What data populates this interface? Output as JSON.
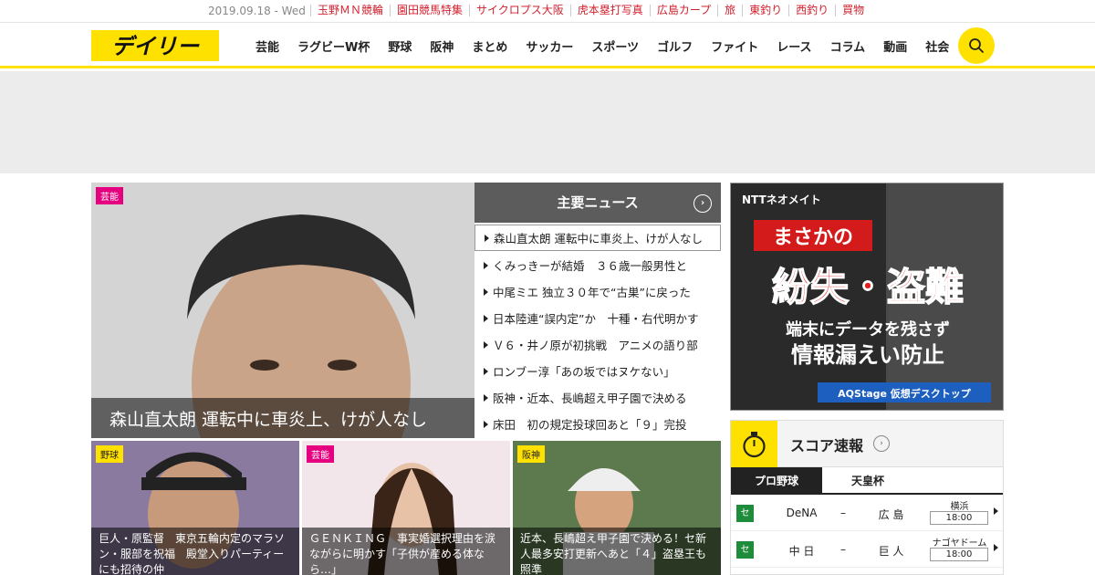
{
  "topbar": {
    "date": "2019.09.18 - Wed",
    "links": [
      "玉野ＭＮ競輪",
      "園田競馬特集",
      "サイクロプス大阪",
      "虎本塁打写真",
      "広島カープ",
      "旅",
      "東釣り",
      "西釣り",
      "買物"
    ]
  },
  "header": {
    "logo_text": "デイリー",
    "nav": [
      "芸能",
      "ラグビーW杯",
      "野球",
      "阪神",
      "まとめ",
      "サッカー",
      "スポーツ",
      "ゴルフ",
      "ファイト",
      "レース",
      "コラム",
      "動画",
      "社会"
    ]
  },
  "hero": {
    "tag": "芸能",
    "caption": "森山直太朗 運転中に車炎上、けが人なし"
  },
  "main_news": {
    "title": "主要ニュース",
    "items": [
      "森山直太朗 運転中に車炎上、けが人なし",
      "くみっきーが結婚　３６歳一般男性と",
      "中尾ミエ 独立３０年で“古巣”に戻った",
      "日本陸連“誤内定”か　十種・右代明かす",
      "Ｖ６・井ノ原が初挑戦　アニメの語り部",
      "ロンブー淳「あの坂ではヌケない」",
      "阪神・近本、長嶋超え甲子園で決める",
      "床田　初の規定投球回あと「９」完投"
    ]
  },
  "cards": [
    {
      "tag": "野球",
      "caption": "巨人・原監督　東京五輪内定のマラソン・服部を祝福　殿堂入りパーティーにも招待の仲"
    },
    {
      "tag": "芸能",
      "caption": "ＧＥＮＫＩＮＧ　事実婚選択理由を涙ながらに明かす「子供が産める体なら…」"
    },
    {
      "tag": "阪神",
      "caption": "近本、長嶋超え甲子園で決める！セ新人最多安打更新へあと「４」盗塁王も照準"
    }
  ],
  "right_ad": {
    "brand": "NTTネオメイト",
    "line1": "まさかの",
    "line2": "紛失・盗難",
    "line3": "端末にデータを残さず",
    "line4": "情報漏えい防止",
    "footer": "AQStage 仮想デスクトップ"
  },
  "score": {
    "title": "スコア速報",
    "tabs": [
      "プロ野球",
      "天皇杯"
    ],
    "games": [
      {
        "league": "セ",
        "team1": "DeNA",
        "team2": "広 島",
        "venue": "横浜",
        "time": "18:00"
      },
      {
        "league": "セ",
        "team1": "中 日",
        "team2": "巨 人",
        "venue": "ナゴヤドーム",
        "time": "18:00"
      }
    ]
  },
  "colors": {
    "accent": "#ffe100",
    "link_red": "#d2202e",
    "tag_pink": "#e4007f"
  }
}
